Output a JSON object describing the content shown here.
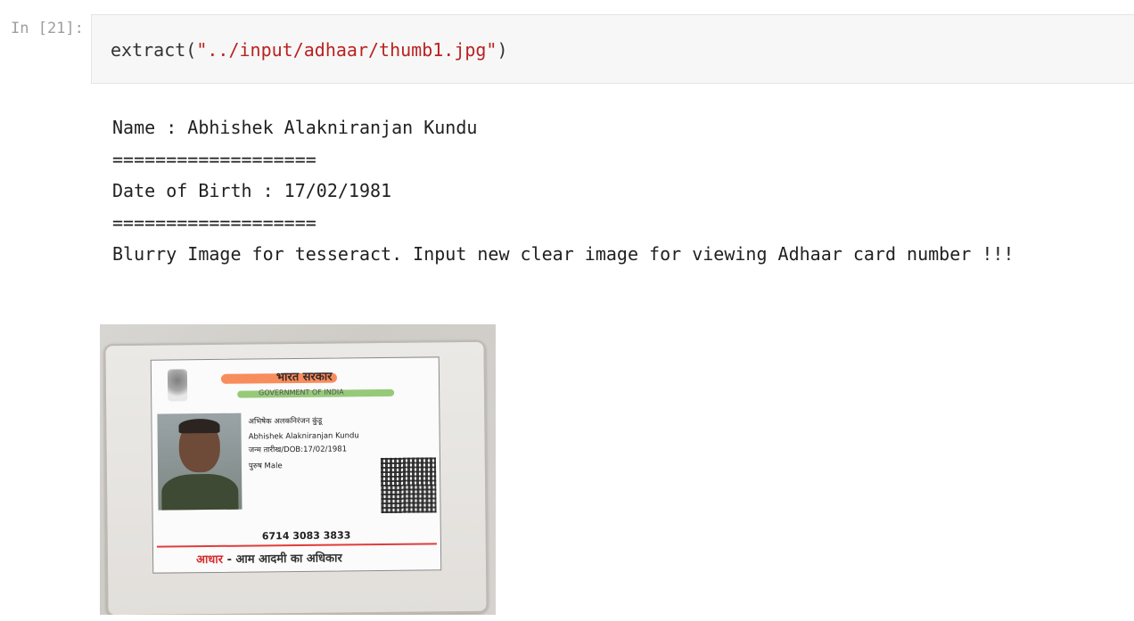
{
  "cell": {
    "prompt": "In [21]:",
    "code": {
      "func": "extract(",
      "arg": "\"../input/adhaar/thumb1.jpg\"",
      "close": ")"
    }
  },
  "output": {
    "lines": [
      "Name : Abhishek Alakniranjan Kundu",
      "===================",
      "Date of Birth : 17/02/1981",
      "===================",
      "Blurry Image for tesseract. Input new clear image for viewing Adhaar card number !!!"
    ],
    "image": {
      "hindi_title": "भारत सरकार",
      "gov_text": "GOVERNMENT OF INDIA",
      "hindi_name": "अभिषेक अलकनिरंजन कुंडू",
      "name": "Abhishek Alakniranjan Kundu",
      "dob_line": "जन्म तारीख/DOB:17/02/1981",
      "gender_line": "पुरुष  Male",
      "number": "6714 3083 3833",
      "footer_red": "आधार",
      "footer_rest": " - आम आदमी का अधिकार"
    }
  },
  "colors": {
    "string": "#ba2121",
    "prompt": "#9e9e9e",
    "input_bg": "#f7f7f7"
  }
}
